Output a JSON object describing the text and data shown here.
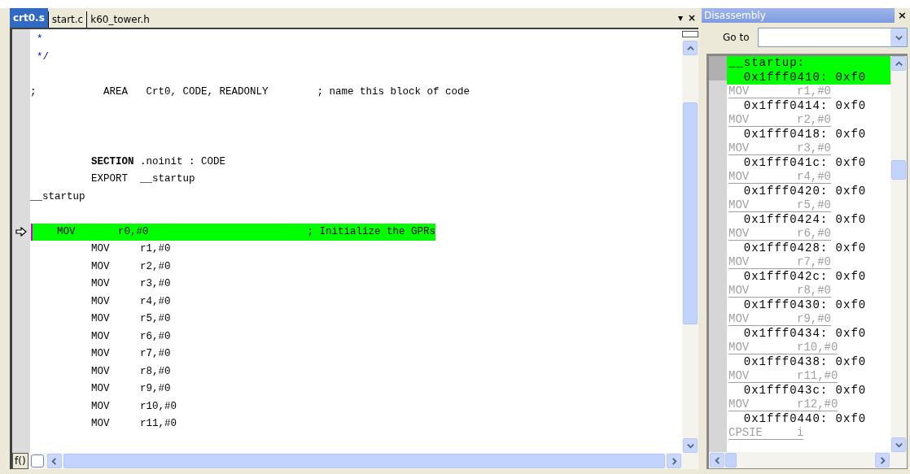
{
  "editor": {
    "tabs": [
      {
        "label": "crt0.s",
        "selected": true
      },
      {
        "label": "start.c",
        "selected": false
      },
      {
        "label": "k60_tower.h",
        "selected": false
      }
    ],
    "tab_menu": "▾",
    "tab_close": "×",
    "lines": [
      {
        "kind": "comment",
        "text": "*",
        "current": false
      },
      {
        "kind": "comment",
        "text": "*/",
        "current": false
      },
      {
        "kind": "blank"
      },
      {
        "kind": "code",
        "text": ";           AREA   Crt0, CODE, READONLY        ; name this block of code",
        "current": false
      },
      {
        "kind": "blank"
      },
      {
        "kind": "blank"
      },
      {
        "kind": "blank"
      },
      {
        "kind": "code",
        "text": "          **SECTION** .noinit : CODE",
        "current": false
      },
      {
        "kind": "code",
        "text": "          EXPORT  __startup",
        "current": false
      },
      {
        "kind": "code",
        "text": "__startup",
        "current": false
      },
      {
        "kind": "blank"
      },
      {
        "kind": "code",
        "text": "    MOV       r0,#0                          ; Initialize the GPRs",
        "current": true
      },
      {
        "kind": "code",
        "text": "          MOV     r1,#0",
        "current": false
      },
      {
        "kind": "code",
        "text": "          MOV     r2,#0",
        "current": false
      },
      {
        "kind": "code",
        "text": "          MOV     r3,#0",
        "current": false
      },
      {
        "kind": "code",
        "text": "          MOV     r4,#0",
        "current": false
      },
      {
        "kind": "code",
        "text": "          MOV     r5,#0",
        "current": false
      },
      {
        "kind": "code",
        "text": "          MOV     r6,#0",
        "current": false
      },
      {
        "kind": "code",
        "text": "          MOV     r7,#0",
        "current": false
      },
      {
        "kind": "code",
        "text": "          MOV     r8,#0",
        "current": false
      },
      {
        "kind": "code",
        "text": "          MOV     r9,#0",
        "current": false
      },
      {
        "kind": "code",
        "text": "          MOV     r10,#0",
        "current": false
      },
      {
        "kind": "code",
        "text": "          MOV     r11,#0",
        "current": false
      }
    ],
    "function_button": "f()"
  },
  "disassembly": {
    "title": "Disassembly",
    "close": "×",
    "goto_label": "Go to",
    "entries": [
      {
        "kind": "label",
        "text": "__startup:",
        "current": true
      },
      {
        "kind": "address",
        "text": "  0x1fff0410: 0xf0",
        "current": true
      },
      {
        "kind": "instruction",
        "text": "MOV       r1,#0",
        "current": false
      },
      {
        "kind": "address",
        "text": "  0x1fff0414: 0xf0",
        "current": false
      },
      {
        "kind": "instruction",
        "text": "MOV       r2,#0",
        "current": false
      },
      {
        "kind": "address",
        "text": "  0x1fff0418: 0xf0",
        "current": false
      },
      {
        "kind": "instruction",
        "text": "MOV       r3,#0",
        "current": false
      },
      {
        "kind": "address",
        "text": "  0x1fff041c: 0xf0",
        "current": false
      },
      {
        "kind": "instruction",
        "text": "MOV       r4,#0",
        "current": false
      },
      {
        "kind": "address",
        "text": "  0x1fff0420: 0xf0",
        "current": false
      },
      {
        "kind": "instruction",
        "text": "MOV       r5,#0",
        "current": false
      },
      {
        "kind": "address",
        "text": "  0x1fff0424: 0xf0",
        "current": false
      },
      {
        "kind": "instruction",
        "text": "MOV       r6,#0",
        "current": false
      },
      {
        "kind": "address",
        "text": "  0x1fff0428: 0xf0",
        "current": false
      },
      {
        "kind": "instruction",
        "text": "MOV       r7,#0",
        "current": false
      },
      {
        "kind": "address",
        "text": "  0x1fff042c: 0xf0",
        "current": false
      },
      {
        "kind": "instruction",
        "text": "MOV       r8,#0",
        "current": false
      },
      {
        "kind": "address",
        "text": "  0x1fff0430: 0xf0",
        "current": false
      },
      {
        "kind": "instruction",
        "text": "MOV       r9,#0",
        "current": false
      },
      {
        "kind": "address",
        "text": "  0x1fff0434: 0xf0",
        "current": false
      },
      {
        "kind": "instruction",
        "text": "MOV       r10,#0",
        "current": false
      },
      {
        "kind": "address",
        "text": "  0x1fff0438: 0xf0",
        "current": false
      },
      {
        "kind": "instruction",
        "text": "MOV       r11,#0",
        "current": false
      },
      {
        "kind": "address",
        "text": "  0x1fff043c: 0xf0",
        "current": false
      },
      {
        "kind": "instruction",
        "text": "MOV       r12,#0",
        "current": false
      },
      {
        "kind": "address",
        "text": "  0x1fff0440: 0xf0",
        "current": false
      },
      {
        "kind": "instruction",
        "text": "CPSIE     i",
        "current": false
      }
    ]
  }
}
